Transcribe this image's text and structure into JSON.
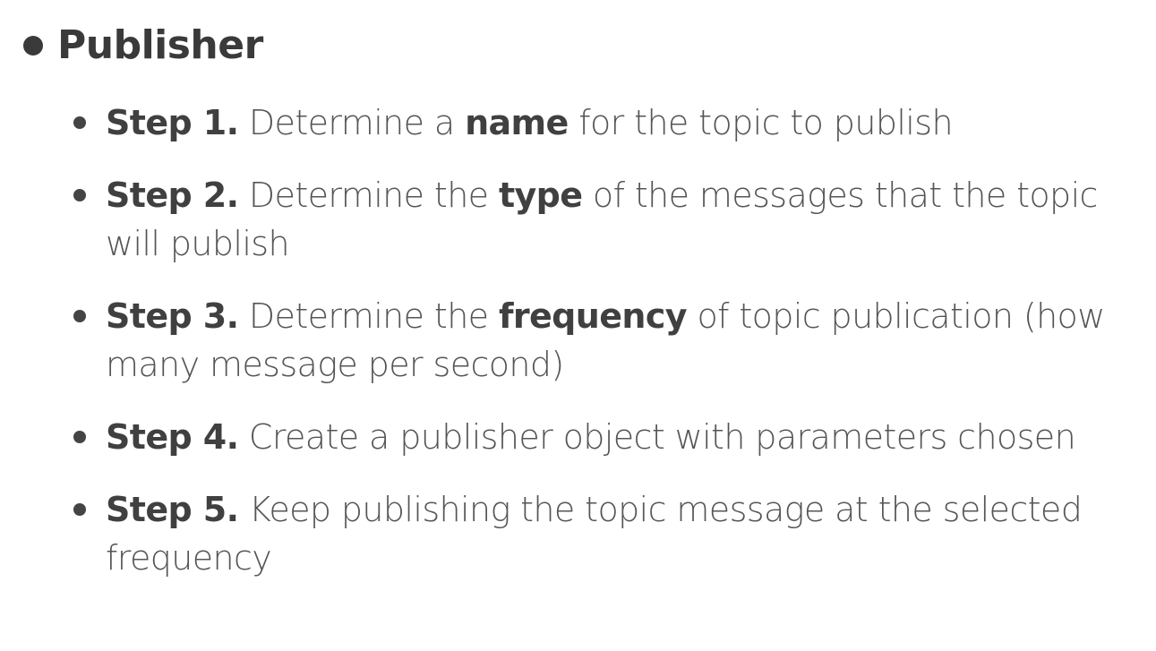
{
  "heading": "Publisher",
  "steps": [
    {
      "label": "Step 1.",
      "pre": " Determine a ",
      "keyword": "name",
      "post": " for the topic to publish"
    },
    {
      "label": "Step 2.",
      "pre": " Determine the ",
      "keyword": "type",
      "post": " of the messages that the topic will publish"
    },
    {
      "label": "Step 3.",
      "pre": " Determine the ",
      "keyword": "frequency",
      "post": " of topic publication (how many message per second)"
    },
    {
      "label": "Step 4.",
      "pre": " Create a publisher object with parameters chosen",
      "keyword": "",
      "post": ""
    },
    {
      "label": "Step 5.",
      "pre": " Keep publishing the topic message at the selected frequency",
      "keyword": "",
      "post": ""
    }
  ],
  "colors": {
    "text": "#555555",
    "bold_text": "#404040",
    "heading": "#3a3a3a",
    "background": "#ffffff"
  }
}
